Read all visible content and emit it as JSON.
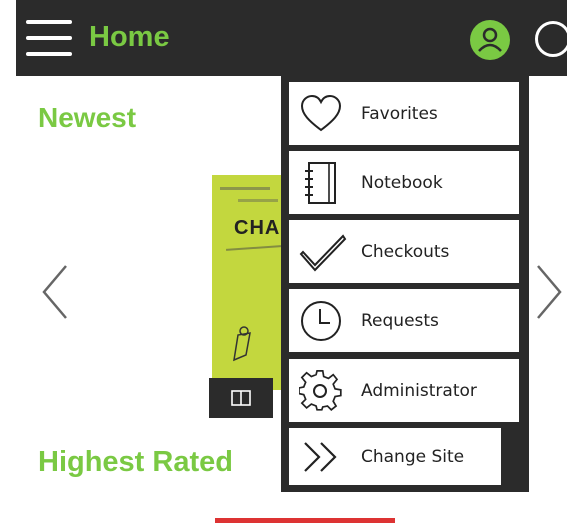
{
  "header": {
    "title": "Home"
  },
  "sections": {
    "newest": "Newest",
    "highest_rated": "Highest Rated"
  },
  "book": {
    "cover_text": "CHA"
  },
  "menu": {
    "items": [
      {
        "label": "Favorites",
        "icon": "heart-icon"
      },
      {
        "label": "Notebook",
        "icon": "notebook-icon"
      },
      {
        "label": "Checkouts",
        "icon": "checkmark-icon"
      },
      {
        "label": "Requests",
        "icon": "clock-icon"
      },
      {
        "label": "Administrator",
        "icon": "gear-icon"
      },
      {
        "label": "Change Site",
        "icon": "double-chevron-right-icon"
      }
    ]
  },
  "colors": {
    "accent": "#7ac943",
    "header_bg": "#2b2b2b"
  }
}
